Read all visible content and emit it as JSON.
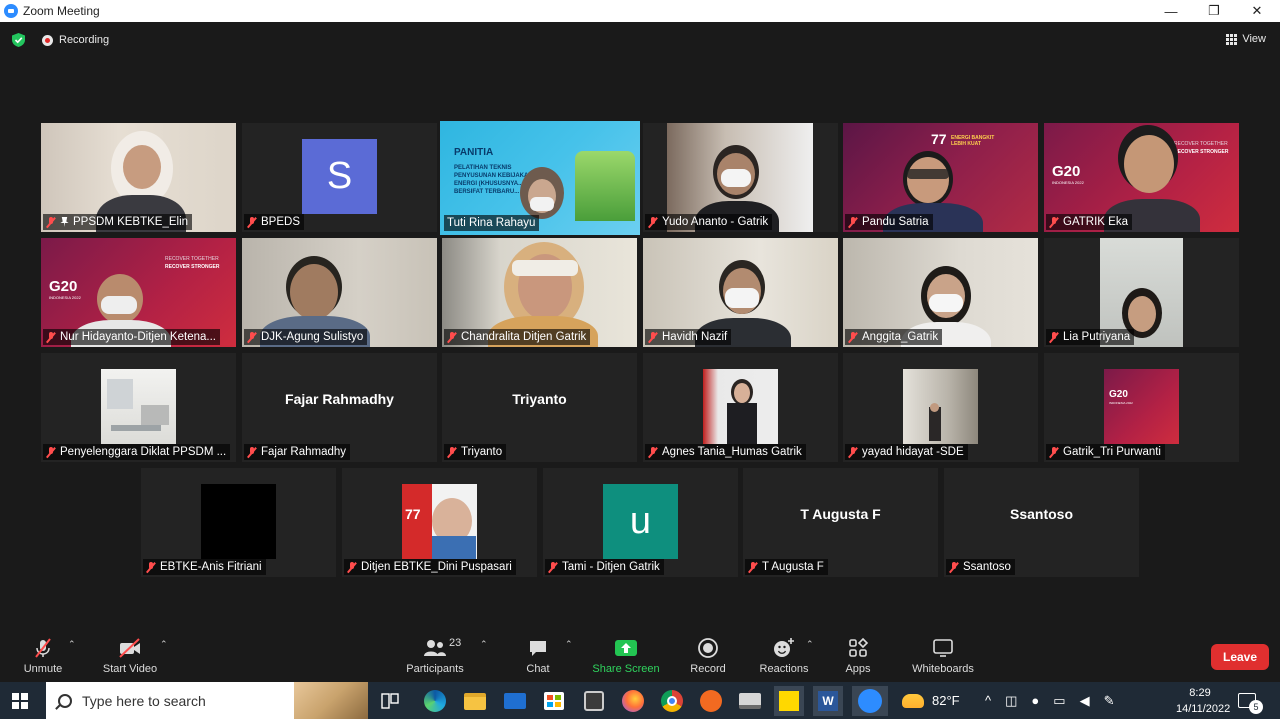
{
  "window": {
    "title": "Zoom Meeting",
    "controls": {
      "minimize": "—",
      "restore": "❐",
      "close": "✕"
    }
  },
  "topbar": {
    "recording": "Recording",
    "view": "View"
  },
  "tiles": [
    {
      "name": "PPSDM KEBTKE_Elin",
      "kind": "video",
      "pinned": true,
      "active": false
    },
    {
      "name": "BPEDS",
      "kind": "avatar",
      "avatar_letter": "S",
      "avatar_color": "#5b6bd6"
    },
    {
      "name": "Tuti Rina Rahayu",
      "kind": "video",
      "active": true,
      "bg_text": [
        "PANITIA",
        "PELATIHAN TEKNIS",
        "PENYUSUNAN KEBIJAKAN...",
        "ENERGI (KHUSUSNYA...",
        "BERSIFAT TERBARU..."
      ]
    },
    {
      "name": "Yudo Ananto - Gatrik",
      "kind": "video"
    },
    {
      "name": "Pandu Satria",
      "kind": "video",
      "bg_text": [
        "77",
        "ENERGI BANGKIT LEBIH KUAT"
      ]
    },
    {
      "name": "GATRIK Eka",
      "kind": "video",
      "bg_text": [
        "G20",
        "INDONESIA 2022",
        "RECOVER TOGETHER",
        "RECOVER STRONGER"
      ]
    },
    {
      "name": "Nur Hidayanto-Ditjen Ketena...",
      "kind": "video",
      "bg_text": [
        "G20",
        "INDONESIA 2022",
        "RECOVER TOGETHER",
        "RECOVER STRONGER"
      ]
    },
    {
      "name": "DJK-Agung Sulistyo",
      "kind": "video"
    },
    {
      "name": "Chandralita Ditjen Gatrik",
      "kind": "video"
    },
    {
      "name": "Havidh Nazif",
      "kind": "video"
    },
    {
      "name": "Anggita_Gatrik",
      "kind": "video"
    },
    {
      "name": "Lia Putriyana",
      "kind": "video"
    },
    {
      "name": "Penyelenggara Diklat PPSDM ...",
      "kind": "thumb"
    },
    {
      "name": "Fajar Rahmadhy",
      "kind": "nameonly",
      "display": "Fajar Rahmadhy"
    },
    {
      "name": "Triyanto",
      "kind": "nameonly",
      "display": "Triyanto"
    },
    {
      "name": "Agnes Tania_Humas Gatrik",
      "kind": "thumb"
    },
    {
      "name": "yayad hidayat -SDE",
      "kind": "thumb"
    },
    {
      "name": "Gatrik_Tri Purwanti",
      "kind": "thumb",
      "bg_text": [
        "G20",
        "INDONESIA 2022"
      ]
    },
    {
      "name": "EBTKE-Anis Fitriani",
      "kind": "thumb"
    },
    {
      "name": "Ditjen EBTKE_Dini Puspasari",
      "kind": "thumb",
      "bg_text": [
        "77"
      ]
    },
    {
      "name": "Tami - Ditjen Gatrik",
      "kind": "avatar",
      "avatar_letter": "u",
      "avatar_color": "#0e8f7e"
    },
    {
      "name": "T Augusta F",
      "kind": "nameonly",
      "display": "T Augusta F"
    },
    {
      "name": "Ssantoso",
      "kind": "nameonly",
      "display": "Ssantoso"
    }
  ],
  "toolbar": {
    "unmute": "Unmute",
    "start_video": "Start Video",
    "participants": "Participants",
    "participants_count": "23",
    "chat": "Chat",
    "share_screen": "Share Screen",
    "record": "Record",
    "reactions": "Reactions",
    "apps": "Apps",
    "whiteboards": "Whiteboards",
    "leave": "Leave"
  },
  "taskbar": {
    "search_placeholder": "Type here to search",
    "weather": "82°F",
    "time": "8:29",
    "date": "14/11/2022",
    "notifications": "5",
    "accent": "#1f2a36"
  }
}
